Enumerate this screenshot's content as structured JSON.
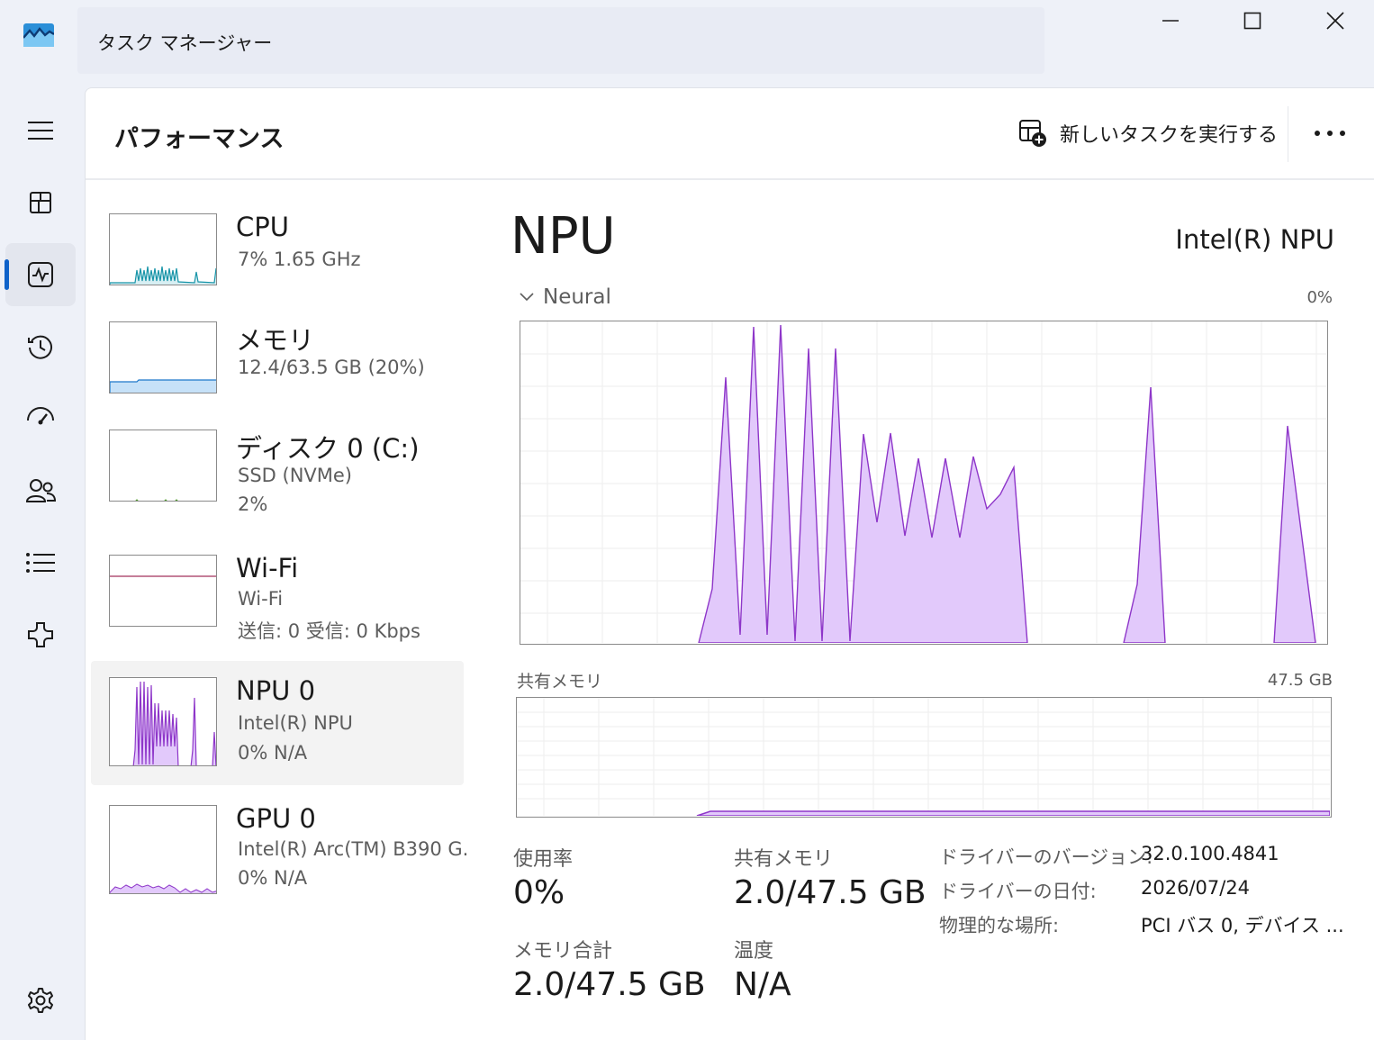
{
  "app": {
    "title": "タスク マネージャー"
  },
  "nav": {
    "items": [
      {
        "icon": "hamburger-menu-icon"
      },
      {
        "icon": "processes-icon"
      },
      {
        "icon": "performance-icon"
      },
      {
        "icon": "app-history-icon"
      },
      {
        "icon": "startup-apps-icon"
      },
      {
        "icon": "users-icon"
      },
      {
        "icon": "details-icon"
      },
      {
        "icon": "services-icon"
      },
      {
        "icon": "settings-icon"
      }
    ],
    "active_index": 2
  },
  "header": {
    "title": "パフォーマンス",
    "run_task_label": "新しいタスクを実行する"
  },
  "devices": [
    {
      "name": "CPU",
      "line1": "7%  1.65 GHz",
      "line2": ""
    },
    {
      "name": "メモリ",
      "line1": "12.4/63.5 GB (20%)",
      "line2": ""
    },
    {
      "name": "ディスク 0 (C:)",
      "line1": "SSD (NVMe)",
      "line2": "2%"
    },
    {
      "name": "Wi-Fi",
      "line1": "Wi-Fi",
      "line2": "送信: 0  受信: 0 Kbps"
    },
    {
      "name": "NPU 0",
      "line1": "Intel(R) NPU",
      "line2": "0%  N/A"
    },
    {
      "name": "GPU 0",
      "line1": "Intel(R) Arc(TM) B390 G.",
      "line2": "0%  N/A"
    }
  ],
  "selected_device_index": 4,
  "main": {
    "title": "NPU",
    "model": "Intel(R) NPU",
    "neural_graph": {
      "label": "Neural",
      "value": "0%"
    },
    "shared_memory_graph": {
      "label": "共有メモリ",
      "value": "47.5 GB"
    },
    "stats": {
      "utilization_label": "使用率",
      "utilization_value": "0%",
      "shared_mem_label": "共有メモリ",
      "shared_mem_value": "2.0/47.5 GB",
      "total_mem_label": "メモリ合計",
      "total_mem_value": "2.0/47.5 GB",
      "temp_label": "温度",
      "temp_value": "N/A"
    },
    "info": [
      {
        "label": "ドライバーのバージョン:",
        "value": "32.0.100.4841"
      },
      {
        "label": "ドライバーの日付:",
        "value": "2026/07/24"
      },
      {
        "label": "物理的な場所:",
        "value": "PCI バス 0, デバイス ..."
      }
    ]
  },
  "colors": {
    "accent": "#0f62c9",
    "npu_line": "#8e36c9",
    "npu_fill": "#e2c9fb",
    "cpu_line": "#1794a8",
    "mem_line": "#1d78c9",
    "mem_fill": "#c6e1f8"
  }
}
